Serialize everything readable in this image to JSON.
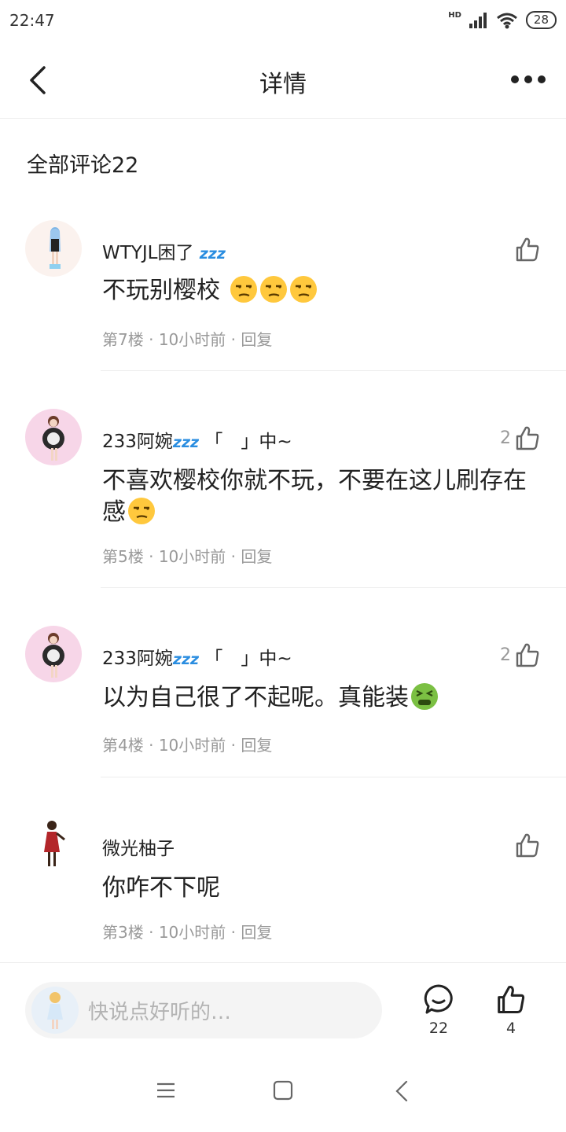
{
  "status_bar": {
    "time": "22:47",
    "network": "HD",
    "battery": "28"
  },
  "header": {
    "title": "详情"
  },
  "section": {
    "title": "全部评论22"
  },
  "comments": [
    {
      "username": "WTYJL困了",
      "badge": "zzz",
      "username_suffix": "",
      "text": "不玩别樱校",
      "emojis": [
        "unamused-face",
        "unamused-face",
        "unamused-face"
      ],
      "floor": "第7楼",
      "time": "10小时前",
      "reply": "回复",
      "likes": ""
    },
    {
      "username": "233阿婉",
      "badge": "zzz",
      "username_suffix": "「　」中~",
      "text": "不喜欢樱校你就不玩，不要在这儿刷存在感",
      "emojis": [
        "unamused-face"
      ],
      "floor": "第5楼",
      "time": "10小时前",
      "reply": "回复",
      "likes": "2"
    },
    {
      "username": "233阿婉",
      "badge": "zzz",
      "username_suffix": "「　」中~",
      "text": "以为自己很了不起呢。真能装",
      "emojis": [
        "nauseated-face"
      ],
      "floor": "第4楼",
      "time": "10小时前",
      "reply": "回复",
      "likes": "2"
    },
    {
      "username": "微光柚子",
      "badge": "",
      "username_suffix": "",
      "text": "你咋不下呢",
      "emojis": [],
      "floor": "第3楼",
      "time": "10小时前",
      "reply": "回复",
      "likes": ""
    }
  ],
  "bottom_bar": {
    "input_placeholder": "快说点好听的…",
    "comment_count": "22",
    "like_count": "4"
  },
  "meta_separator": "·"
}
